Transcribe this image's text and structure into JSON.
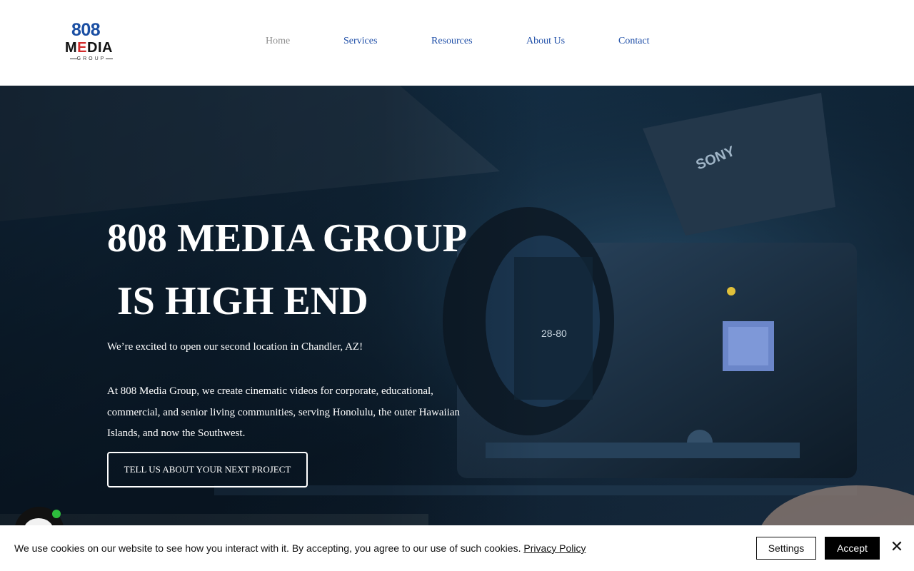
{
  "logo": {
    "top": "808",
    "middle_pre": "M",
    "middle_accent": "E",
    "middle_post": "DIA",
    "bottom": "GROUP"
  },
  "nav": {
    "items": [
      {
        "label": "Home",
        "active": true
      },
      {
        "label": "Services",
        "active": false
      },
      {
        "label": "Resources",
        "active": false
      },
      {
        "label": "About Us",
        "active": false
      },
      {
        "label": "Contact",
        "active": false
      }
    ]
  },
  "hero": {
    "headline": "808 MEDIA GROUP\n IS HIGH END",
    "subline": "We’re excited to open our second location in Chandler, AZ!",
    "body": "At 808 Media Group, we create cinematic videos for corporate, educational, commercial, and senior living communities, serving Honolulu, the outer Hawaiian Islands, and now the Southwest.",
    "cta_label": "TELL US ABOUT YOUR NEXT PROJECT",
    "camera_brand": "SONY",
    "lens_marking": "28-80"
  },
  "cookie_bar": {
    "text": "We use cookies on our website to see how you interact with it. By accepting, you agree to our use of such cookies. ",
    "link_label": "Privacy Policy",
    "settings_label": "Settings",
    "accept_label": "Accept",
    "close_glyph": "✕"
  },
  "colors": {
    "nav_link": "#1f4fa8",
    "nav_active": "#8f8f8f",
    "logo_blue": "#1b4fa3",
    "logo_red": "#d22b2b",
    "hero_text": "#ffffff",
    "accept_bg": "#000000",
    "chat_status": "#2ebd3c"
  },
  "icons": {
    "chat": "chat-bubble-icon",
    "close": "close-icon"
  }
}
